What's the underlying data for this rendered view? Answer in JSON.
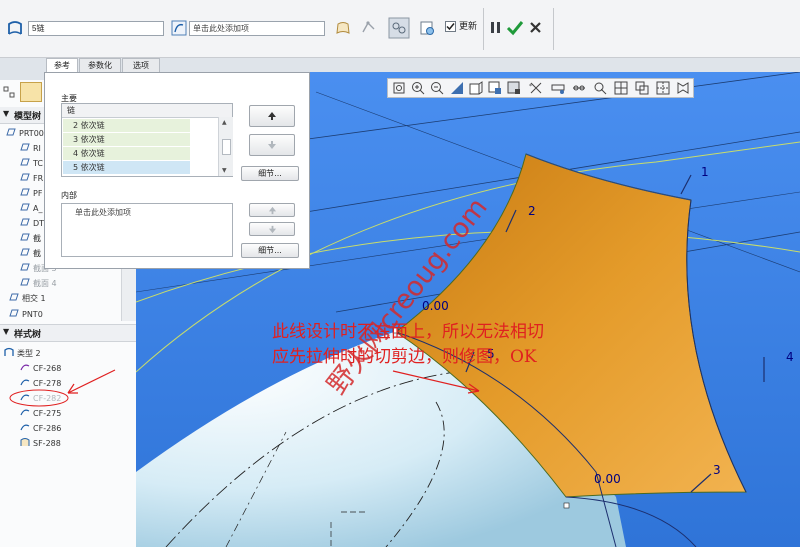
{
  "dashboard": {
    "name_value": "5链",
    "apply_placeholder": "单击此处添加项",
    "update_label": "更新",
    "update_checked": true
  },
  "tabs": [
    "参考",
    "参数化",
    "选项"
  ],
  "ref_panel": {
    "main_label": "主要",
    "chain_header": "链",
    "chains": [
      "2 依次链",
      "3 依次链",
      "4 依次链",
      "5 依次链"
    ],
    "selected_index": 3,
    "details_label": "细节...",
    "internal_label": "内部",
    "internal_placeholder": "单击此处添加项",
    "details_label_2": "细节..."
  },
  "model_tree": {
    "title": "模型树",
    "items": [
      "PRT00",
      "RI",
      "TC",
      "FR",
      "PF",
      "A_",
      "DT",
      "截",
      "截",
      "截面 3",
      "截面 4",
      "相交 1",
      "PNT0"
    ]
  },
  "style_tree": {
    "title": "样式树",
    "root": "类型 2",
    "items": [
      "CF-268",
      "CF-278",
      "CF-282",
      "CF-275",
      "CF-286",
      "SF-288"
    ]
  },
  "viewport": {
    "edge_labels": [
      "1",
      "2",
      "3",
      "4",
      "5"
    ],
    "value_labels": [
      "0.00",
      "0.00"
    ],
    "annotation_line1": "此线设计时不在面上，所以无法相切",
    "annotation_line2": "应先拉伸时的切剪边，则修图，OK",
    "watermark": "野火网creoug.com"
  },
  "colors": {
    "viewport_bg": "#3f84e6",
    "surface": "#d98f1e",
    "annotation": "#e02020",
    "label": "#000080"
  }
}
